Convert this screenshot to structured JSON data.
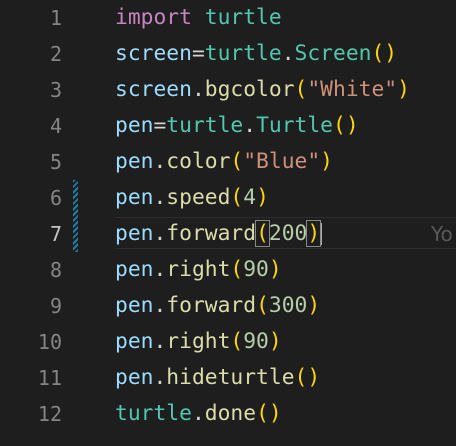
{
  "colors": {
    "background": "#1e1e1e",
    "keyword": "#c586c0",
    "identifier": "#9cdcfe",
    "class_name": "#4ec9b0",
    "function": "#dcdcaa",
    "string": "#ce9178",
    "number": "#b5cea8",
    "punct": "#d4d4d4",
    "bracket": "#ffd700",
    "line_number": "#858585",
    "git_modified": "#1b81a8"
  },
  "editor": {
    "active_line": 7,
    "ghost_text": "Yo",
    "lines": [
      {
        "num": "1",
        "tokens": [
          {
            "t": "import",
            "c": "keyword"
          },
          {
            "t": " ",
            "c": "punct"
          },
          {
            "t": "turtle",
            "c": "class_name"
          }
        ]
      },
      {
        "num": "2",
        "tokens": [
          {
            "t": "screen",
            "c": "identifier"
          },
          {
            "t": "=",
            "c": "punct"
          },
          {
            "t": "turtle",
            "c": "class_name"
          },
          {
            "t": ".",
            "c": "punct"
          },
          {
            "t": "Screen",
            "c": "class_name"
          },
          {
            "t": "()",
            "c": "bracket"
          }
        ]
      },
      {
        "num": "3",
        "tokens": [
          {
            "t": "screen",
            "c": "identifier"
          },
          {
            "t": ".",
            "c": "punct"
          },
          {
            "t": "bgcolor",
            "c": "function"
          },
          {
            "t": "(",
            "c": "bracket"
          },
          {
            "t": "\"White\"",
            "c": "string"
          },
          {
            "t": ")",
            "c": "bracket"
          }
        ]
      },
      {
        "num": "4",
        "tokens": [
          {
            "t": "pen",
            "c": "identifier"
          },
          {
            "t": "=",
            "c": "punct"
          },
          {
            "t": "turtle",
            "c": "class_name"
          },
          {
            "t": ".",
            "c": "punct"
          },
          {
            "t": "Turtle",
            "c": "class_name"
          },
          {
            "t": "()",
            "c": "bracket"
          }
        ]
      },
      {
        "num": "5",
        "tokens": [
          {
            "t": "pen",
            "c": "identifier"
          },
          {
            "t": ".",
            "c": "punct"
          },
          {
            "t": "color",
            "c": "function"
          },
          {
            "t": "(",
            "c": "bracket"
          },
          {
            "t": "\"Blue\"",
            "c": "string"
          },
          {
            "t": ")",
            "c": "bracket"
          }
        ]
      },
      {
        "num": "6",
        "tokens": [
          {
            "t": "pen",
            "c": "identifier"
          },
          {
            "t": ".",
            "c": "punct"
          },
          {
            "t": "speed",
            "c": "function"
          },
          {
            "t": "(",
            "c": "bracket"
          },
          {
            "t": "4",
            "c": "number"
          },
          {
            "t": ")",
            "c": "bracket"
          }
        ]
      },
      {
        "num": "7",
        "tokens": [
          {
            "t": "pen",
            "c": "identifier"
          },
          {
            "t": ".",
            "c": "punct"
          },
          {
            "t": "forward",
            "c": "function"
          },
          {
            "t": "(",
            "c": "bracket",
            "match": true
          },
          {
            "t": "200",
            "c": "number"
          },
          {
            "t": ")",
            "c": "bracket",
            "match": true
          }
        ]
      },
      {
        "num": "8",
        "tokens": [
          {
            "t": "pen",
            "c": "identifier"
          },
          {
            "t": ".",
            "c": "punct"
          },
          {
            "t": "right",
            "c": "function"
          },
          {
            "t": "(",
            "c": "bracket"
          },
          {
            "t": "90",
            "c": "number"
          },
          {
            "t": ")",
            "c": "bracket"
          }
        ]
      },
      {
        "num": "9",
        "tokens": [
          {
            "t": "pen",
            "c": "identifier"
          },
          {
            "t": ".",
            "c": "punct"
          },
          {
            "t": "forward",
            "c": "function"
          },
          {
            "t": "(",
            "c": "bracket"
          },
          {
            "t": "300",
            "c": "number"
          },
          {
            "t": ")",
            "c": "bracket"
          }
        ]
      },
      {
        "num": "10",
        "tokens": [
          {
            "t": "pen",
            "c": "identifier"
          },
          {
            "t": ".",
            "c": "punct"
          },
          {
            "t": "right",
            "c": "function"
          },
          {
            "t": "(",
            "c": "bracket"
          },
          {
            "t": "90",
            "c": "number"
          },
          {
            "t": ")",
            "c": "bracket"
          }
        ]
      },
      {
        "num": "11",
        "tokens": [
          {
            "t": "pen",
            "c": "identifier"
          },
          {
            "t": ".",
            "c": "punct"
          },
          {
            "t": "hideturtle",
            "c": "function"
          },
          {
            "t": "()",
            "c": "bracket"
          }
        ]
      },
      {
        "num": "12",
        "tokens": [
          {
            "t": "turtle",
            "c": "class_name"
          },
          {
            "t": ".",
            "c": "punct"
          },
          {
            "t": "done",
            "c": "function"
          },
          {
            "t": "()",
            "c": "bracket"
          }
        ]
      }
    ]
  }
}
